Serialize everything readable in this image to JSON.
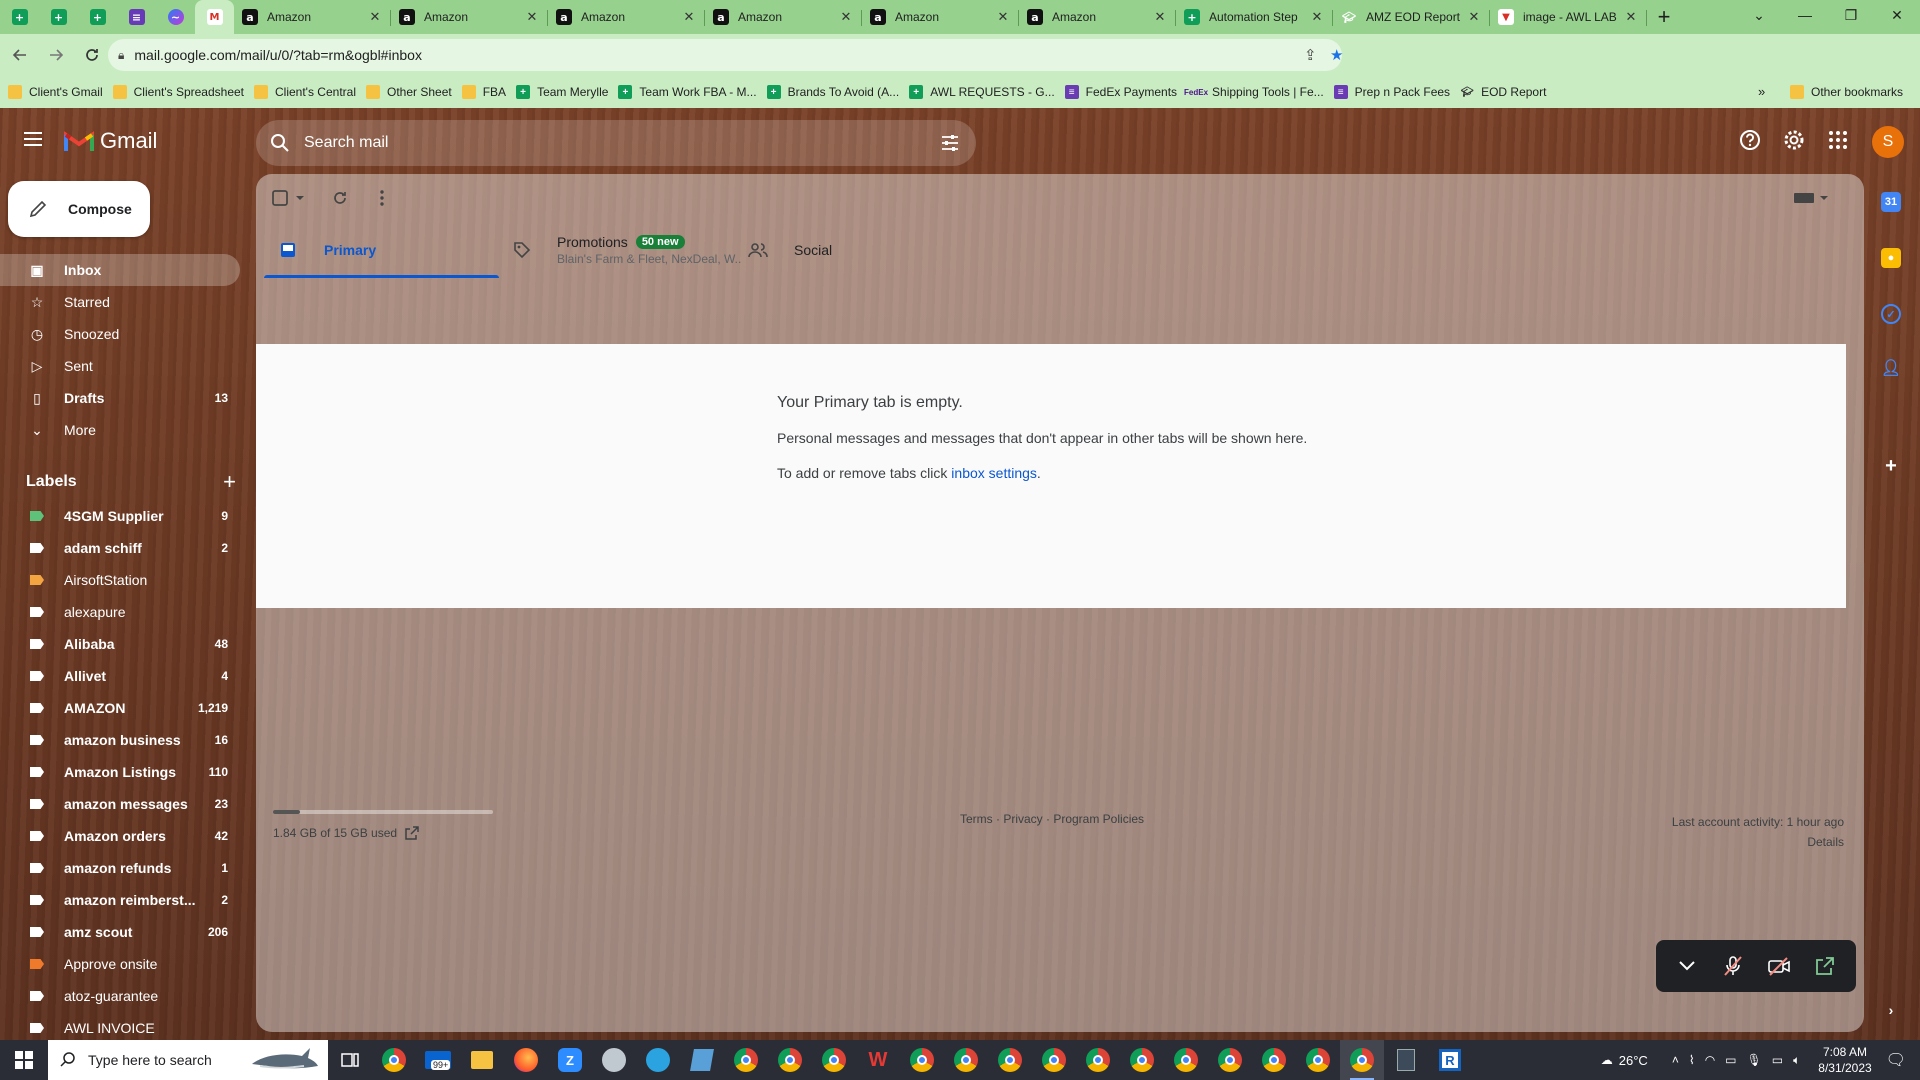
{
  "browser": {
    "tabs": [
      {
        "title": "Amazon",
        "favicon": "amazon"
      },
      {
        "title": "Amazon",
        "favicon": "amazon"
      },
      {
        "title": "Amazon",
        "favicon": "amazon"
      },
      {
        "title": "Amazon",
        "favicon": "amazon"
      },
      {
        "title": "Amazon",
        "favicon": "amazon"
      },
      {
        "title": "Amazon",
        "favicon": "amazon"
      },
      {
        "title": "Automation Step",
        "favicon": "sheets"
      },
      {
        "title": "AMZ EOD Report",
        "favicon": "hat"
      },
      {
        "title": "image - AWL LAB",
        "favicon": "gmail-red"
      }
    ],
    "url": "mail.google.com/mail/u/0/?tab=rm&ogbl#inbox",
    "bookmarks": [
      {
        "label": "Client's Gmail",
        "icon": "folder"
      },
      {
        "label": "Client's Spreadsheet",
        "icon": "folder"
      },
      {
        "label": "Client's Central",
        "icon": "folder"
      },
      {
        "label": "Other Sheet",
        "icon": "folder"
      },
      {
        "label": "FBA",
        "icon": "folder"
      },
      {
        "label": "Team Merylle",
        "icon": "sheet"
      },
      {
        "label": "Team Work FBA - M...",
        "icon": "sheet"
      },
      {
        "label": "Brands To Avoid (A...",
        "icon": "sheet"
      },
      {
        "label": "AWL REQUESTS - G...",
        "icon": "sheet"
      },
      {
        "label": "FedEx Payments",
        "icon": "form"
      },
      {
        "label": "Shipping Tools | Fe...",
        "icon": "fedex"
      },
      {
        "label": "Prep n Pack Fees",
        "icon": "form"
      },
      {
        "label": "EOD Report",
        "icon": "hat"
      }
    ],
    "bookmarks_overflow": "»",
    "other_bookmarks": "Other bookmarks"
  },
  "gmail": {
    "logo_text": "Gmail",
    "search_placeholder": "Search mail",
    "avatar_letter": "S",
    "compose_label": "Compose",
    "nav": [
      {
        "label": "Inbox",
        "icon": "inbox-icon",
        "count": "",
        "active": true
      },
      {
        "label": "Starred",
        "icon": "star-icon",
        "count": "",
        "active": false
      },
      {
        "label": "Snoozed",
        "icon": "clock-icon",
        "count": "",
        "active": false
      },
      {
        "label": "Sent",
        "icon": "send-icon",
        "count": "",
        "active": false
      },
      {
        "label": "Drafts",
        "icon": "draft-icon",
        "count": "13",
        "active": false
      },
      {
        "label": "More",
        "icon": "chevron-down-icon",
        "count": "",
        "active": false
      }
    ],
    "labels_title": "Labels",
    "labels": [
      {
        "name": "4SGM Supplier",
        "count": "9",
        "color": "#5ec27a",
        "bold": true
      },
      {
        "name": "adam schiff",
        "count": "2",
        "color": "#ffffff",
        "bold": true
      },
      {
        "name": "AirsoftStation",
        "count": "",
        "color": "#f2a541",
        "bold": false
      },
      {
        "name": "alexapure",
        "count": "",
        "color": "#ffffff",
        "bold": false
      },
      {
        "name": "Alibaba",
        "count": "48",
        "color": "#ffffff",
        "bold": true
      },
      {
        "name": "Allivet",
        "count": "4",
        "color": "#ffffff",
        "bold": true
      },
      {
        "name": "AMAZON",
        "count": "1,219",
        "color": "#ffffff",
        "bold": true
      },
      {
        "name": "amazon business",
        "count": "16",
        "color": "#ffffff",
        "bold": true
      },
      {
        "name": "Amazon Listings",
        "count": "110",
        "color": "#ffffff",
        "bold": true
      },
      {
        "name": "amazon messages",
        "count": "23",
        "color": "#ffffff",
        "bold": true
      },
      {
        "name": "Amazon orders",
        "count": "42",
        "color": "#ffffff",
        "bold": true
      },
      {
        "name": "amazon refunds",
        "count": "1",
        "color": "#ffffff",
        "bold": true
      },
      {
        "name": "amazon reimberst...",
        "count": "2",
        "color": "#ffffff",
        "bold": true
      },
      {
        "name": "amz scout",
        "count": "206",
        "color": "#ffffff",
        "bold": true
      },
      {
        "name": "Approve onsite",
        "count": "",
        "color": "#f07a2c",
        "bold": false
      },
      {
        "name": "atoz-guarantee",
        "count": "",
        "color": "#ffffff",
        "bold": false
      },
      {
        "name": "AWL INVOICE",
        "count": "",
        "color": "#ffffff",
        "bold": false
      }
    ],
    "tabs": [
      {
        "label": "Primary",
        "icon": "inbox-tab-icon",
        "active": true
      },
      {
        "label": "Promotions",
        "icon": "tag-icon",
        "badge": "50 new",
        "subtitle": "Blain's Farm & Fleet, NexDeal, W..."
      },
      {
        "label": "Social",
        "icon": "people-icon"
      }
    ],
    "empty": {
      "title": "Your Primary tab is empty.",
      "line1": "Personal messages and messages that don't appear in other tabs will be shown here.",
      "line2_prefix": "To add or remove tabs click ",
      "line2_link": "inbox settings",
      "line2_suffix": "."
    },
    "storage": {
      "text": "1.84 GB of 15 GB used",
      "fraction": 0.123
    },
    "legal": "Terms · Privacy · Program Policies",
    "activity": {
      "line1": "Last account activity: 1 hour ago",
      "line2": "Details"
    }
  },
  "taskbar": {
    "search_placeholder": "Type here to search",
    "weather": "26°C",
    "time": "7:08 AM",
    "date": "8/31/2023",
    "mail_badge": "99+"
  },
  "colors": {
    "accent": "#0b57d0",
    "tab_bar": "#97d18e",
    "toolbar": "#c9ecc3",
    "promo_badge": "#188038",
    "avatar": "#e8710a"
  }
}
